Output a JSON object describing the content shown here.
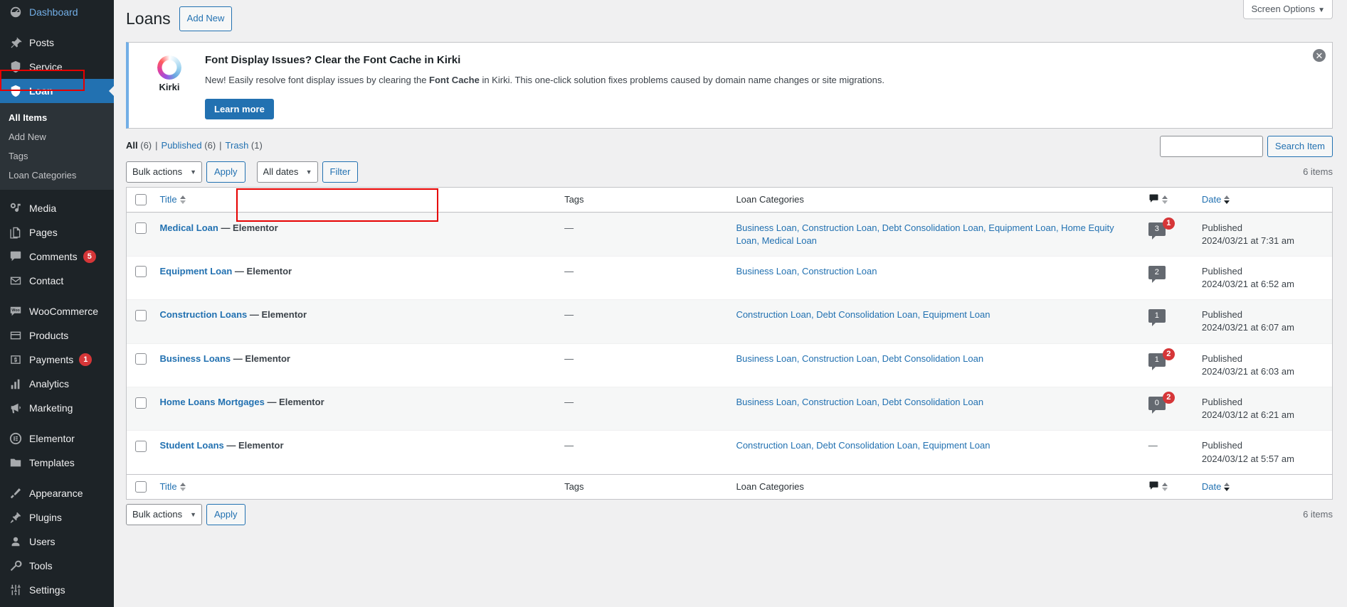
{
  "sidebar": {
    "items": [
      {
        "label": "Dashboard",
        "icon": "dashboard-icon",
        "state": "dashboard"
      },
      {
        "label": "Posts",
        "icon": "pin-icon",
        "state": "normal",
        "sep_before": true
      },
      {
        "label": "Service",
        "icon": "shield-icon",
        "state": "normal"
      },
      {
        "label": "Loan",
        "icon": "shield-icon",
        "state": "current"
      },
      {
        "label": "Media",
        "icon": "media-icon",
        "state": "normal",
        "sep_before": true
      },
      {
        "label": "Pages",
        "icon": "pages-icon",
        "state": "normal"
      },
      {
        "label": "Comments",
        "icon": "comments-icon",
        "state": "normal",
        "badge": "5"
      },
      {
        "label": "Contact",
        "icon": "envelope-icon",
        "state": "normal"
      },
      {
        "label": "WooCommerce",
        "icon": "woo-icon",
        "state": "normal",
        "sep_before": true
      },
      {
        "label": "Products",
        "icon": "products-icon",
        "state": "normal"
      },
      {
        "label": "Payments",
        "icon": "payments-icon",
        "state": "normal",
        "badge": "1"
      },
      {
        "label": "Analytics",
        "icon": "analytics-icon",
        "state": "normal"
      },
      {
        "label": "Marketing",
        "icon": "megaphone-icon",
        "state": "normal"
      },
      {
        "label": "Elementor",
        "icon": "elementor-icon",
        "state": "normal",
        "sep_before": true
      },
      {
        "label": "Templates",
        "icon": "folder-icon",
        "state": "normal"
      },
      {
        "label": "Appearance",
        "icon": "brush-icon",
        "state": "normal",
        "sep_before": true
      },
      {
        "label": "Plugins",
        "icon": "plug-icon",
        "state": "normal"
      },
      {
        "label": "Users",
        "icon": "user-icon",
        "state": "normal"
      },
      {
        "label": "Tools",
        "icon": "wrench-icon",
        "state": "normal"
      },
      {
        "label": "Settings",
        "icon": "settings-icon",
        "state": "normal"
      }
    ],
    "submenu": [
      {
        "label": "All Items",
        "active": true
      },
      {
        "label": "Add New",
        "active": false
      },
      {
        "label": "Tags",
        "active": false
      },
      {
        "label": "Loan Categories",
        "active": false
      }
    ]
  },
  "screen_options": {
    "label": "Screen Options",
    "caret": "▼"
  },
  "header": {
    "title": "Loans",
    "add_new_label": "Add New"
  },
  "notice": {
    "logo_name": "Kirki",
    "title": "Font Display Issues? Clear the Font Cache in Kirki",
    "desc_1": "New! Easily resolve font display issues by clearing the ",
    "desc_strong": "Font Cache",
    "desc_2": " in Kirki. This one-click solution fixes problems caused by domain name changes or site migrations.",
    "button_label": "Learn more",
    "dismiss_glyph": "✕"
  },
  "views": {
    "all_label": "All",
    "all_count": "(6)",
    "published_label": "Published",
    "published_count": "(6)",
    "trash_label": "Trash",
    "trash_count": "(1)",
    "separator": "|"
  },
  "search": {
    "value": "",
    "placeholder": "",
    "button_label": "Search Item"
  },
  "tablenav_top": {
    "bulk_actions_label": "Bulk actions",
    "apply_label": "Apply",
    "dates_label": "All dates",
    "filter_label": "Filter",
    "displaying_num": "6 items"
  },
  "tablenav_bottom": {
    "bulk_actions_label": "Bulk actions",
    "apply_label": "Apply",
    "displaying_num": "6 items"
  },
  "table": {
    "columns": {
      "title": "Title",
      "tags": "Tags",
      "categories": "Loan Categories",
      "comments": "comments-icon",
      "date": "Date"
    },
    "rows": [
      {
        "title": "Medical Loan",
        "suffix": " — Elementor",
        "tags": "—",
        "categories": "Business Loan, Construction Loan, Debt Consolidation Loan, Equipment Loan, Home Equity Loan, Medical Loan",
        "comment_count": "3",
        "pending_count": "1",
        "status": "Published",
        "date": "2024/03/21 at 7:31 am",
        "highlighted": true
      },
      {
        "title": "Equipment Loan",
        "suffix": " — Elementor",
        "tags": "—",
        "categories": "Business Loan, Construction Loan",
        "comment_count": "2",
        "pending_count": "",
        "status": "Published",
        "date": "2024/03/21 at 6:52 am",
        "highlighted": false
      },
      {
        "title": "Construction Loans",
        "suffix": " — Elementor",
        "tags": "—",
        "categories": "Construction Loan, Debt Consolidation Loan, Equipment Loan",
        "comment_count": "1",
        "pending_count": "",
        "status": "Published",
        "date": "2024/03/21 at 6:07 am",
        "highlighted": false
      },
      {
        "title": "Business Loans",
        "suffix": " — Elementor",
        "tags": "—",
        "categories": "Business Loan, Construction Loan, Debt Consolidation Loan",
        "comment_count": "1",
        "pending_count": "2",
        "status": "Published",
        "date": "2024/03/21 at 6:03 am",
        "highlighted": false
      },
      {
        "title": "Home Loans Mortgages",
        "suffix": " — Elementor",
        "tags": "—",
        "categories": "Business Loan, Construction Loan, Debt Consolidation Loan",
        "comment_count": "0",
        "pending_count": "2",
        "status": "Published",
        "date": "2024/03/12 at 6:21 am",
        "highlighted": false
      },
      {
        "title": "Student Loans",
        "suffix": " — Elementor",
        "tags": "—",
        "categories": "Construction Loan, Debt Consolidation Loan, Equipment Loan",
        "comment_count": "",
        "pending_count": "",
        "status": "Published",
        "date": "2024/03/12 at 5:57 am",
        "highlighted": false
      }
    ]
  },
  "colors": {
    "admin_bg": "#1d2327",
    "submenu_bg": "#2c3338",
    "current_blue": "#2271b1",
    "link_blue": "#2271b1",
    "badge_red": "#d63638",
    "highlight_red": "#e60000",
    "page_bg": "#f0f0f1",
    "notice_border": "#72aee6"
  }
}
